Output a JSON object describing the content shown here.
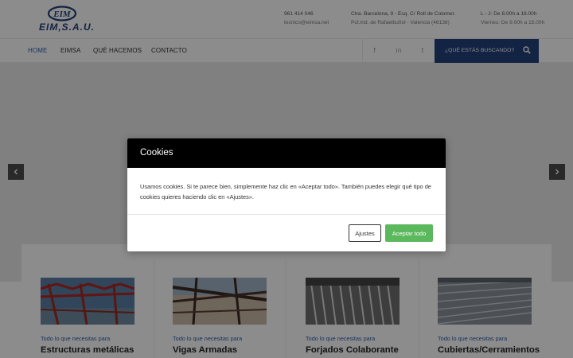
{
  "header": {
    "logo_text": "EIM S.A.U.",
    "phone": "961 414 046",
    "email": "tecnico@eimsa.net",
    "address_line1": "Ctra. Barcelona, 9 - Esq. C/ Roll de Colomer.",
    "address_line2": "Pol.Ind. de Rafaelbuñol - Valencia (46138)",
    "hours_line1": "L - J: De 8.00h a 19.00h",
    "hours_line2": "Viernes: De 9.00h a 15.00h"
  },
  "nav": {
    "items": [
      {
        "label": "HOME",
        "active": true
      },
      {
        "label": "EIMSA",
        "active": false
      },
      {
        "label": "QUÉ HACEMOS",
        "active": false
      },
      {
        "label": "CONTACTO",
        "active": false
      }
    ],
    "social": [
      {
        "icon": "facebook-icon",
        "glyph": "f"
      },
      {
        "icon": "linkedin-icon",
        "glyph": "in"
      },
      {
        "icon": "twitter-icon",
        "glyph": "t"
      }
    ],
    "search_label": "¿QUÉ ESTÁS BUSCANDO?"
  },
  "services": {
    "cards": [
      {
        "subtitle": "Todo lo que necesitas para",
        "title": "Estructuras metálicas"
      },
      {
        "subtitle": "Todo lo que necesitas para",
        "title": "Vigas Armadas"
      },
      {
        "subtitle": "Todo lo que necesitas para",
        "title": "Forjados Colaborante"
      },
      {
        "subtitle": "Todo lo que necesitas para",
        "title": "Cubiertas/Cerramientos"
      }
    ]
  },
  "cookie_modal": {
    "title": "Cookies",
    "body": "Usamos cookies. Si te parece bien, simplemente haz clic en «Aceptar todo». También puedes elegir qué tipo de cookies quieres haciendo clic en «Ajustes».",
    "settings_label": "Ajustes",
    "accept_label": "Aceptar todo"
  },
  "colors": {
    "brand_blue": "#21417a",
    "link_blue": "#2c5fa8",
    "accept_green": "#5cb85c"
  }
}
